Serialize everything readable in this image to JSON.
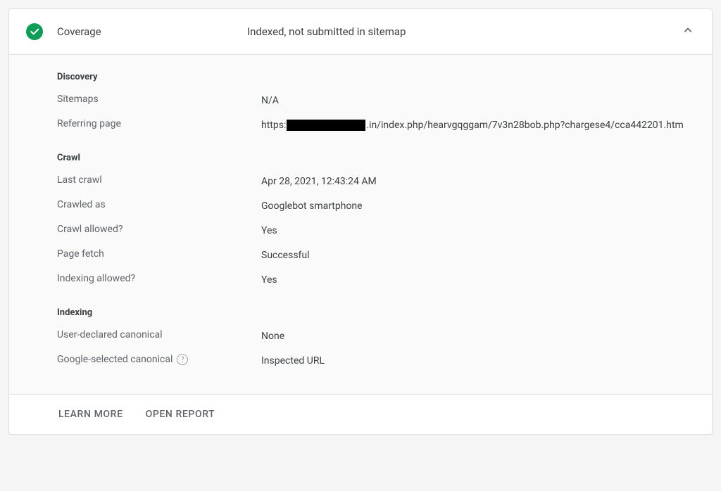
{
  "header": {
    "title": "Coverage",
    "status": "Indexed, not submitted in sitemap"
  },
  "sections": {
    "discovery": {
      "title": "Discovery",
      "sitemaps_label": "Sitemaps",
      "sitemaps_value": "N/A",
      "referring_label": "Referring page",
      "referring_prefix": "https:",
      "referring_suffix": ".in/index.php/hearvgqggam/7v3n28bob.php?chargese4/cca442201.htm"
    },
    "crawl": {
      "title": "Crawl",
      "last_crawl_label": "Last crawl",
      "last_crawl_value": "Apr 28, 2021, 12:43:24 AM",
      "crawled_as_label": "Crawled as",
      "crawled_as_value": "Googlebot smartphone",
      "crawl_allowed_label": "Crawl allowed?",
      "crawl_allowed_value": "Yes",
      "page_fetch_label": "Page fetch",
      "page_fetch_value": "Successful",
      "indexing_allowed_label": "Indexing allowed?",
      "indexing_allowed_value": "Yes"
    },
    "indexing": {
      "title": "Indexing",
      "user_canonical_label": "User-declared canonical",
      "user_canonical_value": "None",
      "google_canonical_label": "Google-selected canonical",
      "google_canonical_value": "Inspected URL"
    }
  },
  "footer": {
    "learn_more": "LEARN MORE",
    "open_report": "OPEN REPORT"
  }
}
